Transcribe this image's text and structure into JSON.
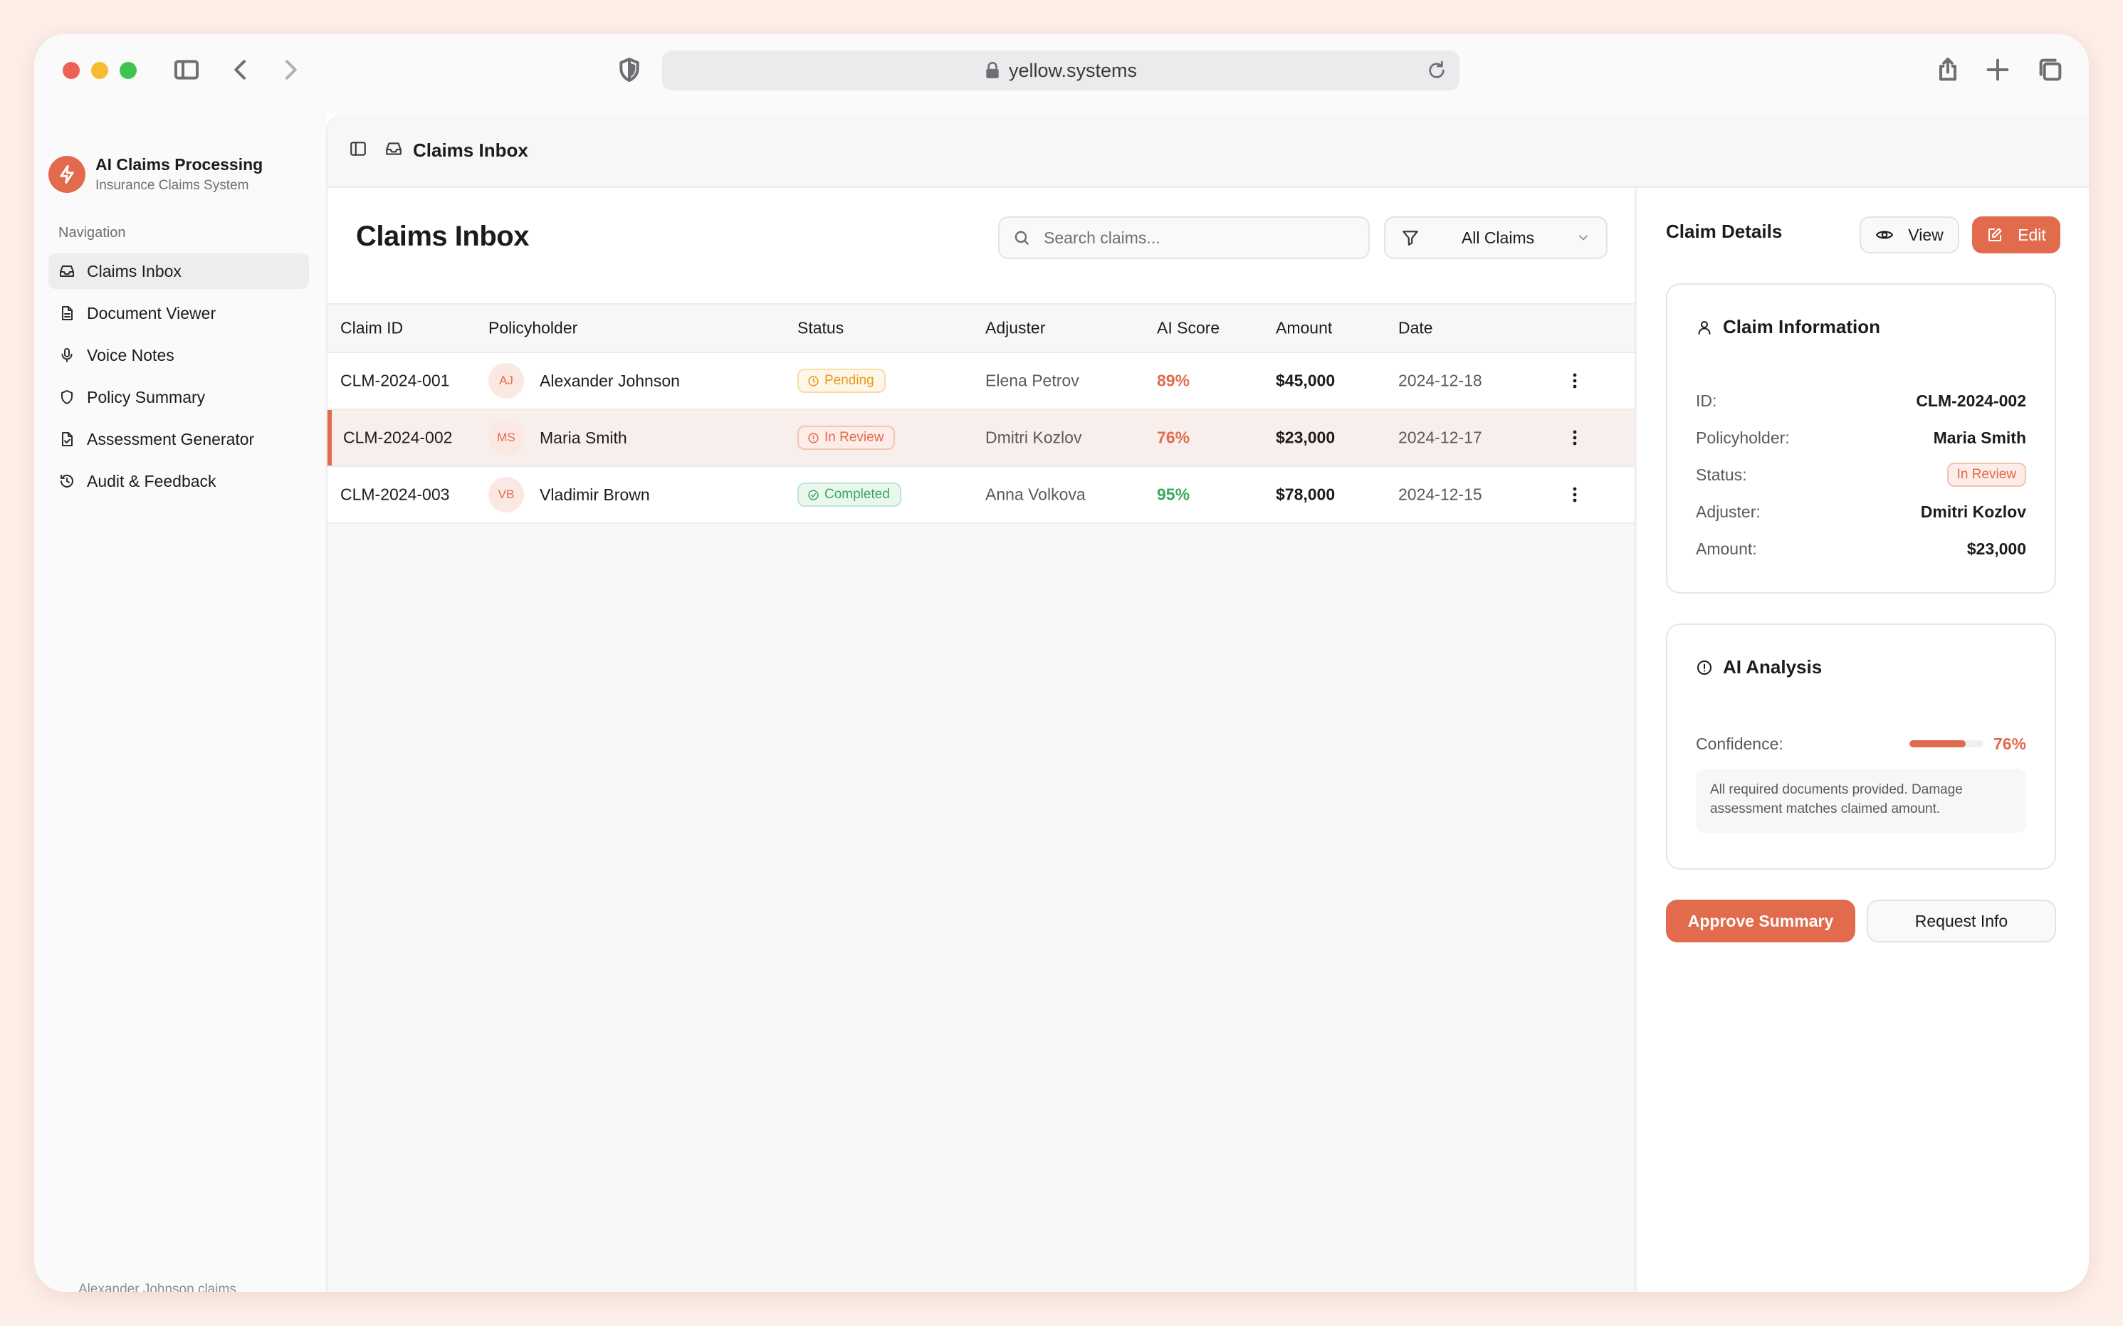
{
  "browser": {
    "url": "yellow.systems"
  },
  "app": {
    "name": "AI Claims Processing",
    "subtitle": "Insurance Claims System",
    "accent": "#e16b4c"
  },
  "sidebar": {
    "heading": "Navigation",
    "items": [
      {
        "label": "Claims Inbox",
        "icon": "inbox-icon",
        "active": true
      },
      {
        "label": "Document Viewer",
        "icon": "document-icon"
      },
      {
        "label": "Voice Notes",
        "icon": "microphone-icon"
      },
      {
        "label": "Policy Summary",
        "icon": "shield-icon"
      },
      {
        "label": "Assessment Generator",
        "icon": "file-check-icon"
      },
      {
        "label": "Audit & Feedback",
        "icon": "history-icon"
      }
    ]
  },
  "topbar": {
    "title": "Claims Inbox"
  },
  "list": {
    "title": "Claims Inbox",
    "search_placeholder": "Search claims...",
    "filter_value": "All Claims",
    "columns": [
      "Claim ID",
      "Policyholder",
      "Status",
      "Adjuster",
      "AI Score",
      "Amount",
      "Date"
    ],
    "rows": [
      {
        "id": "CLM-2024-001",
        "initials": "AJ",
        "name": "Alexander Johnson",
        "status": "Pending",
        "adjuster": "Elena Petrov",
        "ai_score": "89%",
        "amount": "$45,000",
        "date": "2024-12-18"
      },
      {
        "id": "CLM-2024-002",
        "initials": "MS",
        "name": "Maria Smith",
        "status": "In Review",
        "adjuster": "Dmitri Kozlov",
        "ai_score": "76%",
        "amount": "$23,000",
        "date": "2024-12-17"
      },
      {
        "id": "CLM-2024-003",
        "initials": "VB",
        "name": "Vladimir Brown",
        "status": "Completed",
        "adjuster": "Anna Volkova",
        "ai_score": "95%",
        "amount": "$78,000",
        "date": "2024-12-15"
      }
    ]
  },
  "detail": {
    "title": "Claim Details",
    "view_label": "View",
    "edit_label": "Edit",
    "info": {
      "title": "Claim Information",
      "id_label": "ID:",
      "id_value": "CLM-2024-002",
      "policyholder_label": "Policyholder:",
      "policyholder_value": "Maria Smith",
      "status_label": "Status:",
      "status_value": "In Review",
      "adjuster_label": "Adjuster:",
      "adjuster_value": "Dmitri Kozlov",
      "amount_label": "Amount:",
      "amount_value": "$23,000"
    },
    "ai": {
      "title": "AI Analysis",
      "confidence_label": "Confidence:",
      "confidence_value": "76%",
      "confidence_fraction": 0.76,
      "note": "All required documents provided. Damage assessment matches claimed amount."
    },
    "approve_label": "Approve Summary",
    "request_label": "Request Info"
  },
  "footer_hint": "Alexander Johnson claims"
}
